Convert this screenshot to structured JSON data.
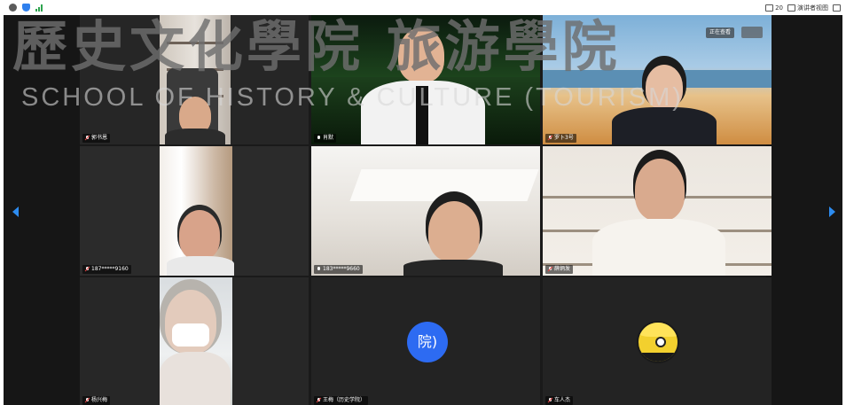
{
  "topbar": {
    "signal_color": "#2ea44f",
    "view_count": "20",
    "speaker_view_label": "演讲者视图"
  },
  "watermark": {
    "title": "歷史文化學院 旅游學院",
    "subtitle": "SCHOOL OF HISTORY & CULTURE (TOURISM)"
  },
  "stage": {
    "status_label": "正在查看",
    "accent_color": "#2d8cf0"
  },
  "participants": [
    {
      "name": "郭书恩",
      "mic": "muted",
      "video": "study"
    },
    {
      "name": "肖默",
      "mic": "on",
      "video": "night"
    },
    {
      "name": "罗卜3号",
      "mic": "muted",
      "video": "beach"
    },
    {
      "name": "187*****9160",
      "mic": "muted",
      "video": "room"
    },
    {
      "name": "183*****9660",
      "mic": "on",
      "video": "ceiling"
    },
    {
      "name": "薛炳发",
      "mic": "muted",
      "video": "shelves"
    },
    {
      "name": "杨兴梅",
      "mic": "muted",
      "video": "masked"
    },
    {
      "name": "王梅（历史学院）",
      "mic": "muted",
      "video": "avatar",
      "avatar_text": "院)"
    },
    {
      "name": "车人杰",
      "mic": "muted",
      "video": "cartoon-avatar"
    }
  ]
}
